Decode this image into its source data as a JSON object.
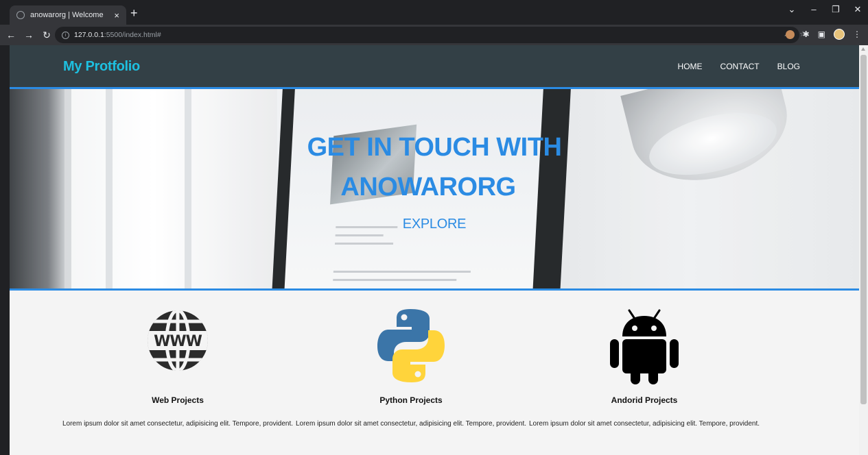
{
  "browser": {
    "tab_title": "anowarorg | Welcome",
    "tab_close": "×",
    "new_tab": "+",
    "url_host": "127.0.0.1",
    "url_path": ":5500/index.html#"
  },
  "site": {
    "brand": "My Protfolio",
    "nav": [
      {
        "label": "HOME"
      },
      {
        "label": "CONTACT"
      },
      {
        "label": "BLOG"
      }
    ],
    "hero": {
      "title_line1": "GET IN TOUCH WITH",
      "title_line2": "ANOWARORG",
      "cta": "EXPLORE"
    },
    "projects": [
      {
        "icon": "www-globe-icon",
        "title": "Web Projects",
        "text": "Lorem ipsum dolor sit amet consectetur, adipisicing elit. Tempore, provident."
      },
      {
        "icon": "python-logo-icon",
        "title": "Python Projects",
        "text": "Lorem ipsum dolor sit amet consectetur, adipisicing elit. Tempore, provident."
      },
      {
        "icon": "android-robot-icon",
        "title": "Andorid Projects",
        "text": "Lorem ipsum dolor sit amet consectetur, adipisicing elit. Tempore, provident."
      }
    ]
  },
  "colors": {
    "accent_blue": "#2b8be3",
    "brand_cyan": "#1ec0e0",
    "navbar_bg": "#334046",
    "python_blue": "#3b75a8",
    "python_yellow": "#ffd43b"
  }
}
